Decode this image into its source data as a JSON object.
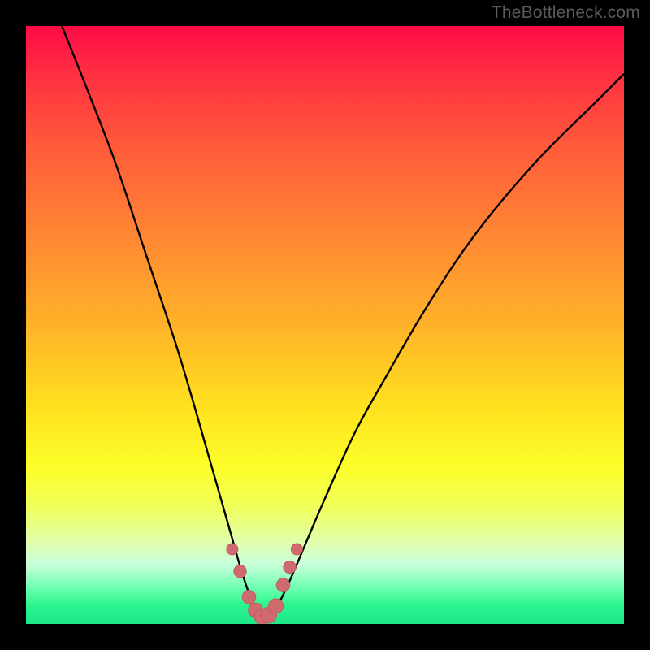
{
  "watermark": "TheBottleneck.com",
  "chart_data": {
    "type": "line",
    "title": "",
    "xlabel": "",
    "ylabel": "",
    "xlim": [
      0,
      100
    ],
    "ylim": [
      0,
      100
    ],
    "series": [
      {
        "name": "bottleneck-curve",
        "x": [
          6,
          10,
          15,
          20,
          25,
          28,
          30,
          32,
          34,
          36,
          37.5,
          38.5,
          39.5,
          40.5,
          42,
          44,
          47,
          50,
          55,
          60,
          67,
          75,
          85,
          95,
          100
        ],
        "values": [
          100,
          90,
          77,
          62,
          47,
          37,
          30,
          23,
          16,
          9,
          4.5,
          2,
          1,
          1.5,
          3,
          7,
          14,
          21,
          32,
          41,
          53,
          65,
          77,
          87,
          92
        ]
      }
    ],
    "markers": {
      "name": "highlight-dots",
      "x": [
        34.5,
        35.8,
        37.3,
        38.4,
        39.5,
        40.6,
        41.8,
        43.0,
        44.1,
        45.3
      ],
      "values": [
        12.5,
        8.8,
        4.5,
        2.3,
        1.2,
        1.5,
        3.0,
        6.5,
        9.5,
        12.5
      ]
    },
    "gradient_stops": [
      {
        "pos": 0,
        "color": "#ff0a47"
      },
      {
        "pos": 8,
        "color": "#ff2f42"
      },
      {
        "pos": 20,
        "color": "#ff5a3a"
      },
      {
        "pos": 34,
        "color": "#ff8434"
      },
      {
        "pos": 50,
        "color": "#ffb229"
      },
      {
        "pos": 64,
        "color": "#ffe21e"
      },
      {
        "pos": 74,
        "color": "#fcff2a"
      },
      {
        "pos": 80,
        "color": "#f1ff56"
      },
      {
        "pos": 86,
        "color": "#e2ffa8"
      },
      {
        "pos": 90,
        "color": "#c9ffdb"
      },
      {
        "pos": 94,
        "color": "#6cffb0"
      },
      {
        "pos": 97,
        "color": "#29f58e"
      },
      {
        "pos": 100,
        "color": "#1ee68a"
      }
    ],
    "colors": {
      "curve": "#000000",
      "marker_fill": "#cf6a6f",
      "marker_stroke": "#c25a60"
    }
  }
}
